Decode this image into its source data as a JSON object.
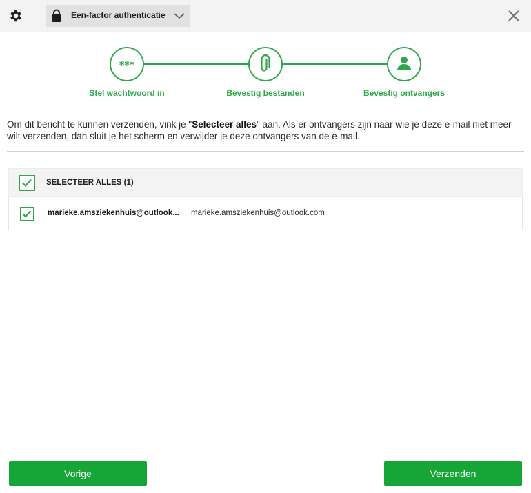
{
  "header": {
    "auth_mode_label": "Een-factor authenticatie"
  },
  "steps": [
    {
      "label": "Stel wachtwoord in",
      "icon": "asterisks-icon",
      "symbol": "***"
    },
    {
      "label": "Bevestig bestanden",
      "icon": "paperclip-icon"
    },
    {
      "label": "Bevestig ontvangers",
      "icon": "user-icon"
    }
  ],
  "instruction": {
    "part1": "Om dit bericht te kunnen verzenden, vink je \"",
    "bold": "Selecteer alles",
    "part2": "\" aan. Als er ontvangers zijn naar wie je deze e-mail niet meer wilt verzenden, dan sluit je het scherm en verwijder je deze ontvangers van de e-mail."
  },
  "select_all": {
    "label": "SELECTEER ALLES (1)",
    "checked": true
  },
  "recipients": [
    {
      "name": "marieke.amsziekenhuis@outlook...",
      "email": "marieke.amsziekenhuis@outlook.com",
      "checked": true
    }
  ],
  "footer": {
    "prev_label": "Vorige",
    "send_label": "Verzenden"
  },
  "colors": {
    "accent": "#2ea84a",
    "button": "#16a637",
    "topbar": "#f3f3f3"
  }
}
